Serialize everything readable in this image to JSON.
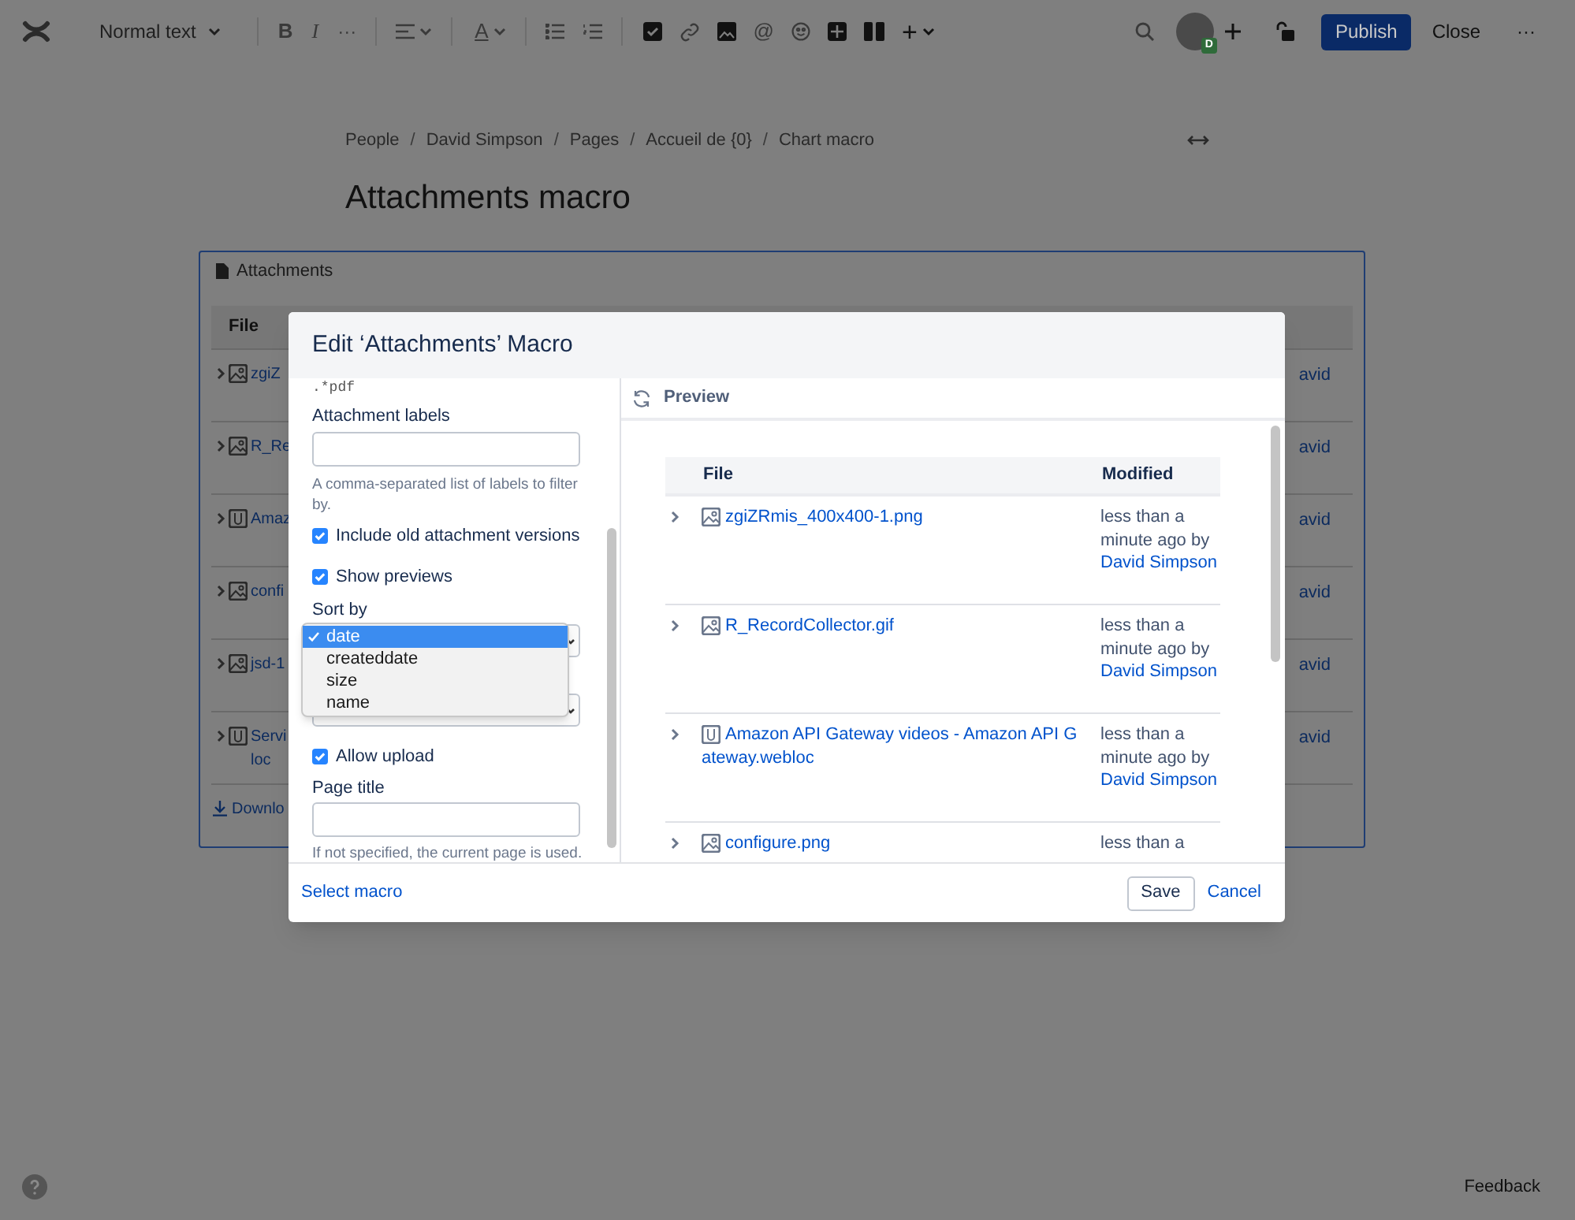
{
  "toolbar": {
    "style_menu": "Normal text",
    "bold": "B",
    "italic": "I",
    "more": "···",
    "text_color": "A",
    "mention": "@",
    "insert": "+",
    "avatar_badge": "D",
    "publish": "Publish",
    "close": "Close",
    "overflow": "···"
  },
  "breadcrumbs": [
    {
      "kind": "link",
      "text": "People"
    },
    {
      "kind": "separator",
      "text": "/"
    },
    {
      "kind": "link",
      "text": "David Simpson"
    },
    {
      "kind": "separator",
      "text": "/"
    },
    {
      "kind": "link",
      "text": "Pages"
    },
    {
      "kind": "separator",
      "text": "/"
    },
    {
      "kind": "link",
      "text": "Accueil de {0}"
    },
    {
      "kind": "separator",
      "text": "/"
    },
    {
      "kind": "link",
      "text": "Chart macro"
    }
  ],
  "page_title": "Attachments macro",
  "background_macro": {
    "title": "Attachments",
    "column_1": "File",
    "rows": [
      {
        "kind": "image",
        "name": "zgiZ",
        "author": "avid"
      },
      {
        "kind": "image",
        "name": "R_Re",
        "author": "avid"
      },
      {
        "kind": "link",
        "name": "Amaz",
        "author": "avid"
      },
      {
        "kind": "image",
        "name": "confi",
        "author": "avid"
      },
      {
        "kind": "image",
        "name": "jsd-1",
        "author": "avid"
      },
      {
        "kind": "link",
        "name": "Servi loc",
        "author": "avid"
      }
    ],
    "download": "Downlo"
  },
  "dialog": {
    "title": "Edit ‘Attachments’ Macro",
    "filter_value": ".*pdf",
    "labels_label": "Attachment labels",
    "labels_help": "A comma-separated list of labels to filter by.",
    "options": [
      {
        "label": "Include old attachment versions",
        "checked": true
      },
      {
        "label": "Show previews",
        "checked": true
      }
    ],
    "sort_label": "Sort by",
    "sort_options": [
      {
        "label": "date",
        "selected": true
      },
      {
        "label": "createddate",
        "selected": false
      },
      {
        "label": "size",
        "selected": false
      },
      {
        "label": "name",
        "selected": false
      }
    ],
    "allow_upload": {
      "label": "Allow upload",
      "checked": true
    },
    "page_title_label": "Page title",
    "page_title_help": "If not specified, the current page is used.",
    "preview_label": "Preview",
    "preview_columns": [
      "File",
      "Modified"
    ],
    "preview_rows": [
      {
        "kind": "image",
        "name": "zgiZRmis_400x400-1.png",
        "modified": "less than a minute ago by",
        "author": "David Simpson"
      },
      {
        "kind": "image",
        "name": "R_RecordCollector.gif",
        "modified": "less than a minute ago by",
        "author": "David Simpson"
      },
      {
        "kind": "link",
        "name": "Amazon API Gateway videos - Amazon API Gateway.webloc",
        "modified": "less than a minute ago by",
        "author": "David Simpson"
      },
      {
        "kind": "image",
        "name": "configure.png",
        "modified": "less than a"
      }
    ],
    "select_macro": "Select macro",
    "save": "Save",
    "cancel": "Cancel"
  },
  "feedback": "Feedback"
}
